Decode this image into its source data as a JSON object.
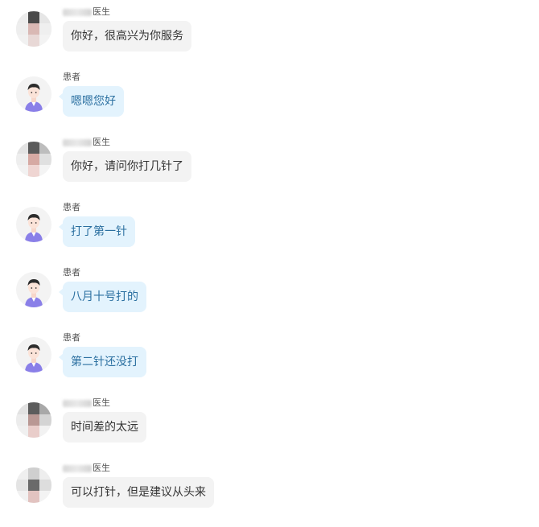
{
  "colors": {
    "doctor_bubble": "#f3f3f3",
    "patient_bubble": "#e3f3fd",
    "patient_text": "#2a6fa0"
  },
  "messages": [
    {
      "role": "doctor",
      "sender": "医生",
      "text": "你好，很高兴为你服务"
    },
    {
      "role": "patient",
      "sender": "患者",
      "text": "嗯嗯您好"
    },
    {
      "role": "doctor",
      "sender": "医生",
      "text": "你好，请问你打几针了"
    },
    {
      "role": "patient",
      "sender": "患者",
      "text": "打了第一针"
    },
    {
      "role": "patient",
      "sender": "患者",
      "text": "八月十号打的"
    },
    {
      "role": "patient",
      "sender": "患者",
      "text": "第二针还没打"
    },
    {
      "role": "doctor",
      "sender": "医生",
      "text": "时间差的太远"
    },
    {
      "role": "doctor",
      "sender": "医生",
      "text": "可以打针，但是建议从头来"
    }
  ]
}
